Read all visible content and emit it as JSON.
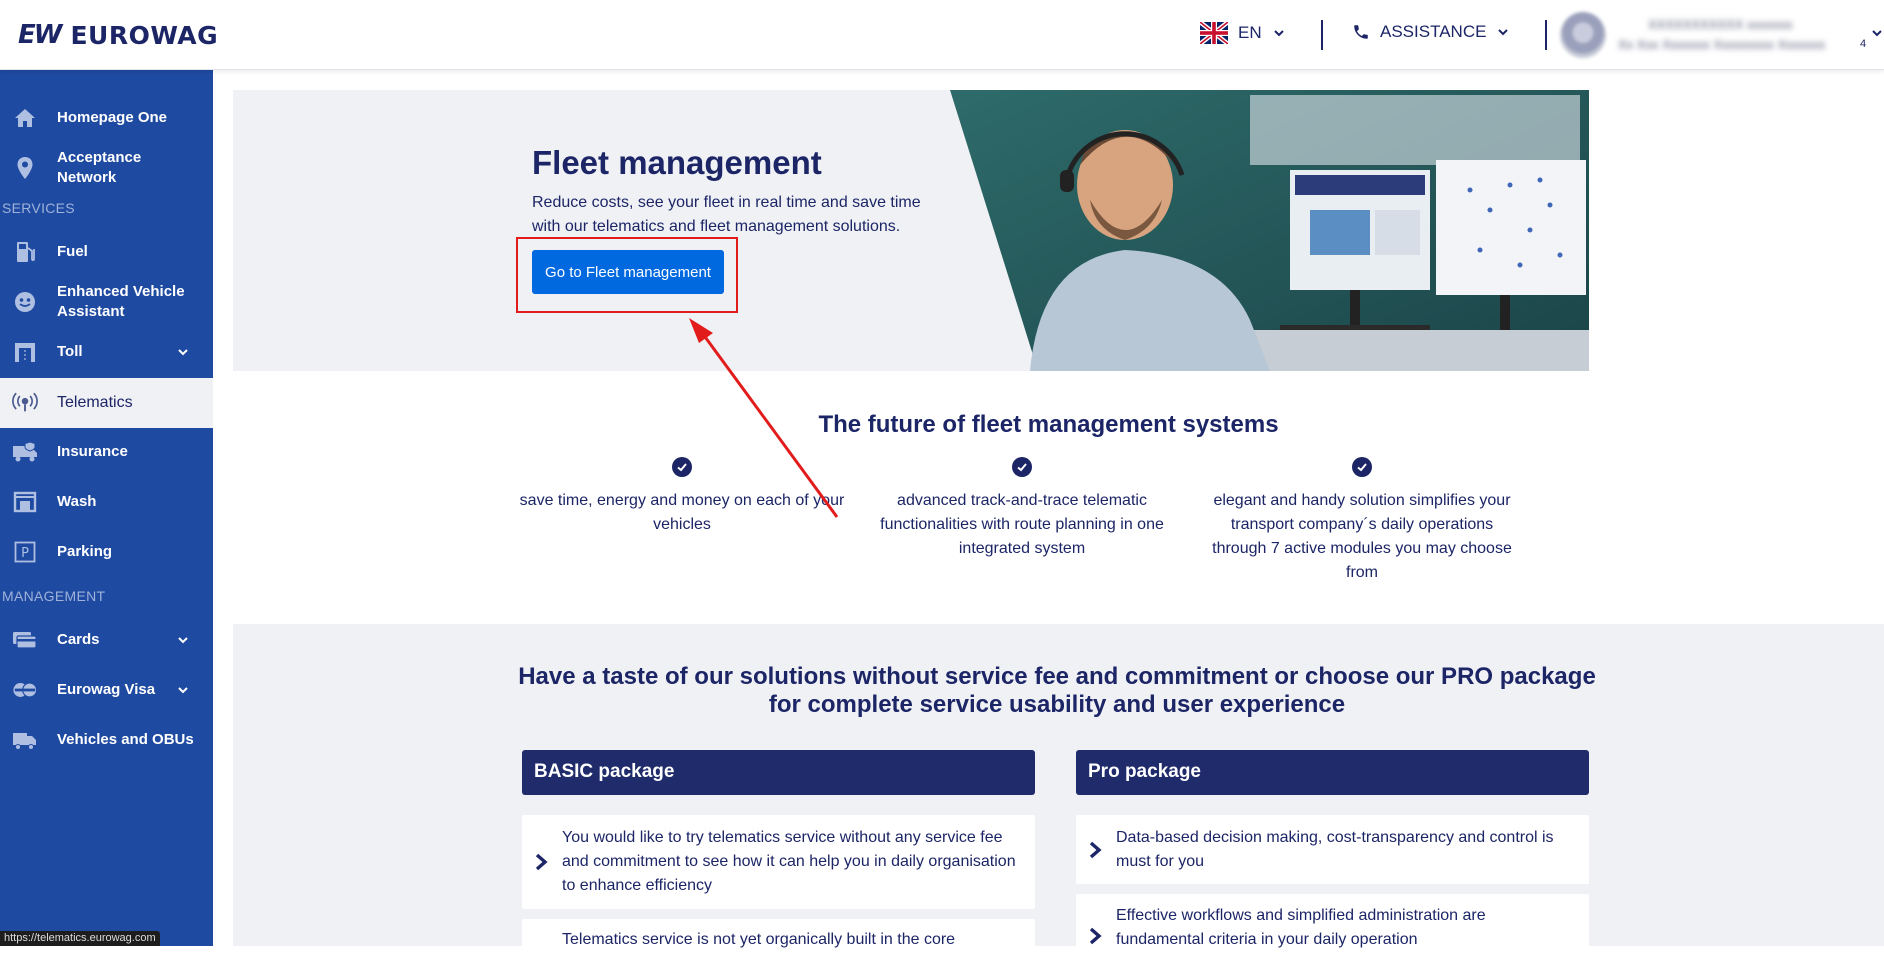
{
  "header": {
    "brand_mark": "EW",
    "brand_name": "EUROWAG",
    "language": "EN",
    "assistance_label": "ASSISTANCE",
    "user_line1": "XXXXXXXXXXX xxxxxxx",
    "user_line2": "Xx Xxx Xxxxxxx Xxxxxxxxx Xxxxxxx",
    "user_badge": "4"
  },
  "sidebar": {
    "items": [
      {
        "label": "Homepage One",
        "icon": "home-icon"
      },
      {
        "label": "Acceptance Network",
        "icon": "location-pin-icon"
      },
      {
        "label": "Fuel",
        "icon": "fuel-pump-icon"
      },
      {
        "label": "Enhanced Vehicle Assistant",
        "icon": "assistant-icon"
      },
      {
        "label": "Toll",
        "icon": "toll-gate-icon"
      },
      {
        "label": "Telematics",
        "icon": "telematics-icon"
      },
      {
        "label": "Insurance",
        "icon": "insurance-truck-icon"
      },
      {
        "label": "Wash",
        "icon": "wash-icon"
      },
      {
        "label": "Parking",
        "icon": "parking-icon"
      },
      {
        "label": "Cards",
        "icon": "cards-icon"
      },
      {
        "label": "Eurowag Visa",
        "icon": "visa-icon"
      },
      {
        "label": "Vehicles and OBUs",
        "icon": "truck-icon"
      }
    ],
    "section_services": "SERVICES",
    "section_management": "MANAGEMENT",
    "status_url": "https://telematics.eurowag.com"
  },
  "hero": {
    "title": "Fleet management",
    "description": "Reduce costs, see your fleet in real time and save time with our telematics and fleet management solutions.",
    "button_label": "Go to Fleet management"
  },
  "features": {
    "title": "The future of fleet management systems",
    "items": [
      "save time, energy and money on each of your vehicles",
      "advanced track-and-trace telematic functionalities with route planning in one integrated system",
      "elegant and handy solution simplifies your transport company´s daily operations through 7 active modules you may choose from"
    ]
  },
  "packages": {
    "title": "Have a taste of our solutions without service fee and commitment or choose our PRO package for complete service usability and user experience",
    "basic": {
      "name": "BASIC package",
      "items": [
        "You would like to try telematics service without any service fee and commitment to see how it can help you in daily organisation to enhance efficiency",
        "Telematics service is not yet organically built in the core"
      ]
    },
    "pro": {
      "name": "Pro package",
      "items": [
        "Data-based decision making, cost-transparency and control is must for you",
        "Effective workflows and simplified administration are fundamental criteria in your daily operation"
      ]
    }
  },
  "colors": {
    "sidebar": "#1f4aa1",
    "primary_button": "#0069e0",
    "navy": "#1c2566",
    "highlight": "#e21b1b"
  }
}
